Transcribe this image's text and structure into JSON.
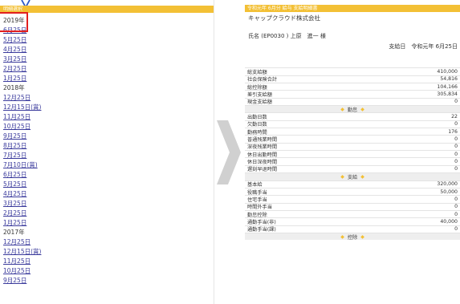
{
  "left": {
    "header": "明細選択",
    "items": [
      {
        "type": "year",
        "text": "2019年"
      },
      {
        "type": "link",
        "text": "6月25日"
      },
      {
        "type": "link",
        "text": "5月25日"
      },
      {
        "type": "link",
        "text": "4月25日"
      },
      {
        "type": "link",
        "text": "3月25日"
      },
      {
        "type": "link",
        "text": "2月25日"
      },
      {
        "type": "link",
        "text": "1月25日"
      },
      {
        "type": "year",
        "text": "2018年"
      },
      {
        "type": "link",
        "text": "12月25日"
      },
      {
        "type": "link",
        "text": "12月15日(賞)"
      },
      {
        "type": "link",
        "text": "11月25日"
      },
      {
        "type": "link",
        "text": "10月25日"
      },
      {
        "type": "link",
        "text": "9月25日"
      },
      {
        "type": "link",
        "text": "8月25日"
      },
      {
        "type": "link",
        "text": "7月25日"
      },
      {
        "type": "link",
        "text": "7月10日(賞)"
      },
      {
        "type": "link",
        "text": "6月25日"
      },
      {
        "type": "link",
        "text": "5月25日"
      },
      {
        "type": "link",
        "text": "4月25日"
      },
      {
        "type": "link",
        "text": "3月25日"
      },
      {
        "type": "link",
        "text": "2月25日"
      },
      {
        "type": "link",
        "text": "1月25日"
      },
      {
        "type": "year",
        "text": "2017年"
      },
      {
        "type": "link",
        "text": "12月25日"
      },
      {
        "type": "link",
        "text": "12月15日(賞)"
      },
      {
        "type": "link",
        "text": "11月25日"
      },
      {
        "type": "link",
        "text": "10月25日"
      },
      {
        "type": "link",
        "text": "9月25日"
      }
    ]
  },
  "right": {
    "header": "令和元年 6月分 給与 支給明細書",
    "company": "キャップクラウド株式会社",
    "name_line": "氏名 (EP0030 ) 上原　進一 様",
    "pay_date": "支給日　令和元年 6月25日",
    "rows": [
      {
        "type": "spacer"
      },
      {
        "type": "row",
        "label": "総支給額",
        "value": "410,000"
      },
      {
        "type": "row",
        "label": "社会保険合計",
        "value": "54,816"
      },
      {
        "type": "row",
        "label": "総控除額",
        "value": "104,166"
      },
      {
        "type": "row",
        "label": "差引支給額",
        "value": "305,834"
      },
      {
        "type": "row",
        "label": "現金支給額",
        "value": "0"
      },
      {
        "type": "section",
        "label": "勤怠"
      },
      {
        "type": "row",
        "label": "出勤日数",
        "value": "22"
      },
      {
        "type": "row",
        "label": "欠勤日数",
        "value": "0"
      },
      {
        "type": "row",
        "label": "勤務時間",
        "value": "176"
      },
      {
        "type": "row",
        "label": "普通残業時間",
        "value": "0"
      },
      {
        "type": "row",
        "label": "深夜残業時間",
        "value": "0"
      },
      {
        "type": "row",
        "label": "休日出勤時間",
        "value": "0"
      },
      {
        "type": "row",
        "label": "休日深夜時間",
        "value": "0"
      },
      {
        "type": "row",
        "label": "遅刻早退時間",
        "value": "0"
      },
      {
        "type": "section",
        "label": "支給"
      },
      {
        "type": "row",
        "label": "基本給",
        "value": "320,000"
      },
      {
        "type": "row",
        "label": "役職手当",
        "value": "50,000"
      },
      {
        "type": "row",
        "label": "住宅手当",
        "value": "0"
      },
      {
        "type": "row",
        "label": "時間外手当",
        "value": "0"
      },
      {
        "type": "row",
        "label": "勤怠控除",
        "value": "0"
      },
      {
        "type": "row",
        "label": "通勤手当(非)",
        "value": "40,000"
      },
      {
        "type": "row",
        "label": "通勤手当(課)",
        "value": "0"
      },
      {
        "type": "section",
        "label": "控除"
      }
    ]
  },
  "colors": {
    "accent": "#f3c035",
    "highlight": "#e21f1f",
    "link": "#3a3a9c"
  }
}
